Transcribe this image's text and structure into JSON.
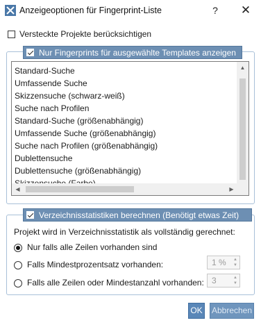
{
  "window": {
    "title": "Anzeigeoptionen für Fingerprint-Liste",
    "help": "?",
    "close": "✕"
  },
  "hidden_projects": {
    "label": "Versteckte Projekte berücksichtigen",
    "checked": false
  },
  "templates_group": {
    "header": "Nur Fingerprints für ausgewählte Templates anzeigen",
    "checked": true,
    "items": [
      "Standard-Suche",
      "Umfassende Suche",
      "Skizzensuche (schwarz-weiß)",
      "Suche nach Profilen",
      "Standard-Suche (größenabhängig)",
      "Umfassende Suche (größenabhängig)",
      "Suche nach Profilen (größenabhängig)",
      "Dublettensuche",
      "Dublettensuche (größenabhängig)",
      "Skizzensuche (Farbe)"
    ]
  },
  "stats_group": {
    "header": "Verzeichnisstatistiken berechnen (Benötigt etwas Zeit)",
    "checked": true,
    "question": "Projekt wird in Verzeichnisstatistik als vollständig gerechnet:",
    "options": [
      {
        "label": "Nur falls alle Zeilen vorhanden sind",
        "selected": true
      },
      {
        "label": "Falls Mindestprozentsatz vorhanden:",
        "selected": false,
        "value": "1 %"
      },
      {
        "label": "Falls alle Zeilen oder Mindestanzahl vorhanden:",
        "selected": false,
        "value": "3"
      }
    ]
  },
  "buttons": {
    "ok": "OK",
    "cancel": "Abbrechen"
  },
  "colors": {
    "group_header": "#6d8fb3",
    "ok_button": "#5a87b8"
  }
}
